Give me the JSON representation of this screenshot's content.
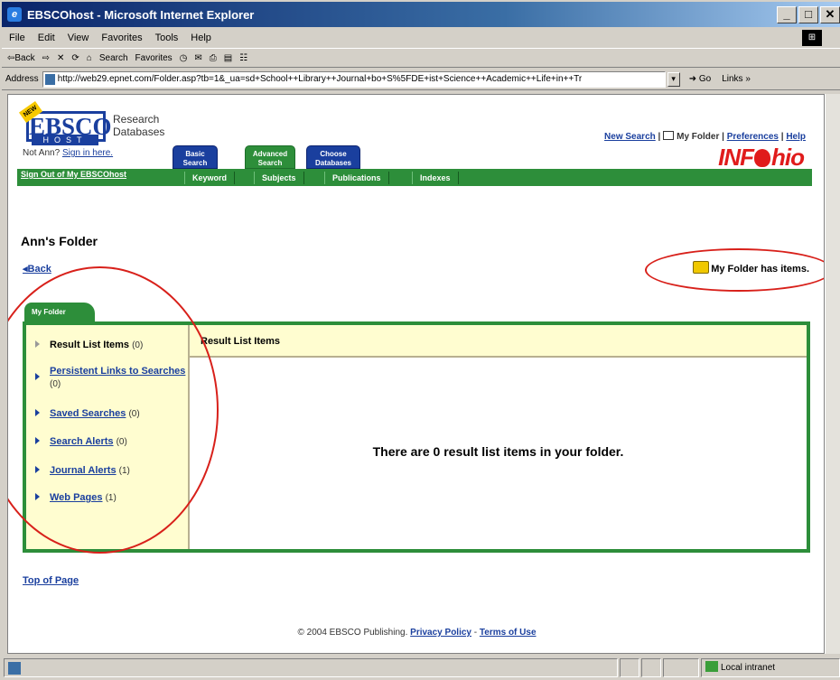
{
  "window": {
    "title": "EBSCOhost - Microsoft Internet Explorer"
  },
  "menu": [
    "File",
    "Edit",
    "View",
    "Favorites",
    "Tools",
    "Help"
  ],
  "toolbar": {
    "back": "⇦Back",
    "forward": "⇨",
    "stop": "✕",
    "refresh": "⟳",
    "home": "⌂",
    "search": "Search",
    "favorites": "Favorites",
    "history": "◷",
    "mail": "✉",
    "print": "⎙",
    "edit": "▤",
    "discuss": "☷"
  },
  "address": {
    "label": "Address",
    "url": "http://web29.epnet.com/Folder.asp?tb=1&_ua=sd+School++Library++Journal+bo+S%5FDE+ist+Science++Academic++Life+in++Tr",
    "go": "Go",
    "links": "Links"
  },
  "header": {
    "brand_ebsco": "EBSCO",
    "brand_host": "HOST",
    "brand_research": "Research",
    "brand_databases": "Databases",
    "not_user": "Not Ann?",
    "sign_in": "Sign in here.",
    "tabs": [
      {
        "l1": "Basic",
        "l2": "Search"
      },
      {
        "l1": "Advanced",
        "l2": "Search"
      },
      {
        "l1": "Choose",
        "l2": "Databases"
      }
    ],
    "sign_out": "Sign Out of My EBSCOhost",
    "subtabs": [
      "Keyword",
      "Subjects",
      "Publications",
      "Indexes"
    ],
    "links": {
      "new_search": "New Search",
      "my_folder": "My Folder",
      "preferences": "Preferences",
      "help": "Help"
    },
    "infohio_a": "INF",
    "infohio_b": "hio"
  },
  "page": {
    "title": "Ann's Folder",
    "back": "◂Back",
    "folder_status": "My Folder has items.",
    "folder_tab": "My Folder",
    "right_header": "Result List Items",
    "empty_message": "There are 0 result list items in your folder.",
    "top_of_page": "Top of Page"
  },
  "left_items": [
    {
      "label": "Result List Items",
      "count": "(0)"
    },
    {
      "label": "Persistent Links to Searches",
      "count": "(0)"
    },
    {
      "label": "Saved Searches",
      "count": "(0)"
    },
    {
      "label": "Search Alerts",
      "count": "(0)"
    },
    {
      "label": "Journal Alerts",
      "count": "(1)"
    },
    {
      "label": "Web Pages",
      "count": "(1)"
    }
  ],
  "footer": {
    "copyright": "© 2004 EBSCO Publishing.",
    "privacy": "Privacy Policy",
    "sep": "-",
    "terms": "Terms of Use"
  },
  "status": {
    "zone": "Local intranet"
  },
  "colors": {
    "green": "#2d8e3a",
    "blue": "#1a3f9e",
    "cream": "#fffdd0",
    "red": "#d8201a"
  }
}
